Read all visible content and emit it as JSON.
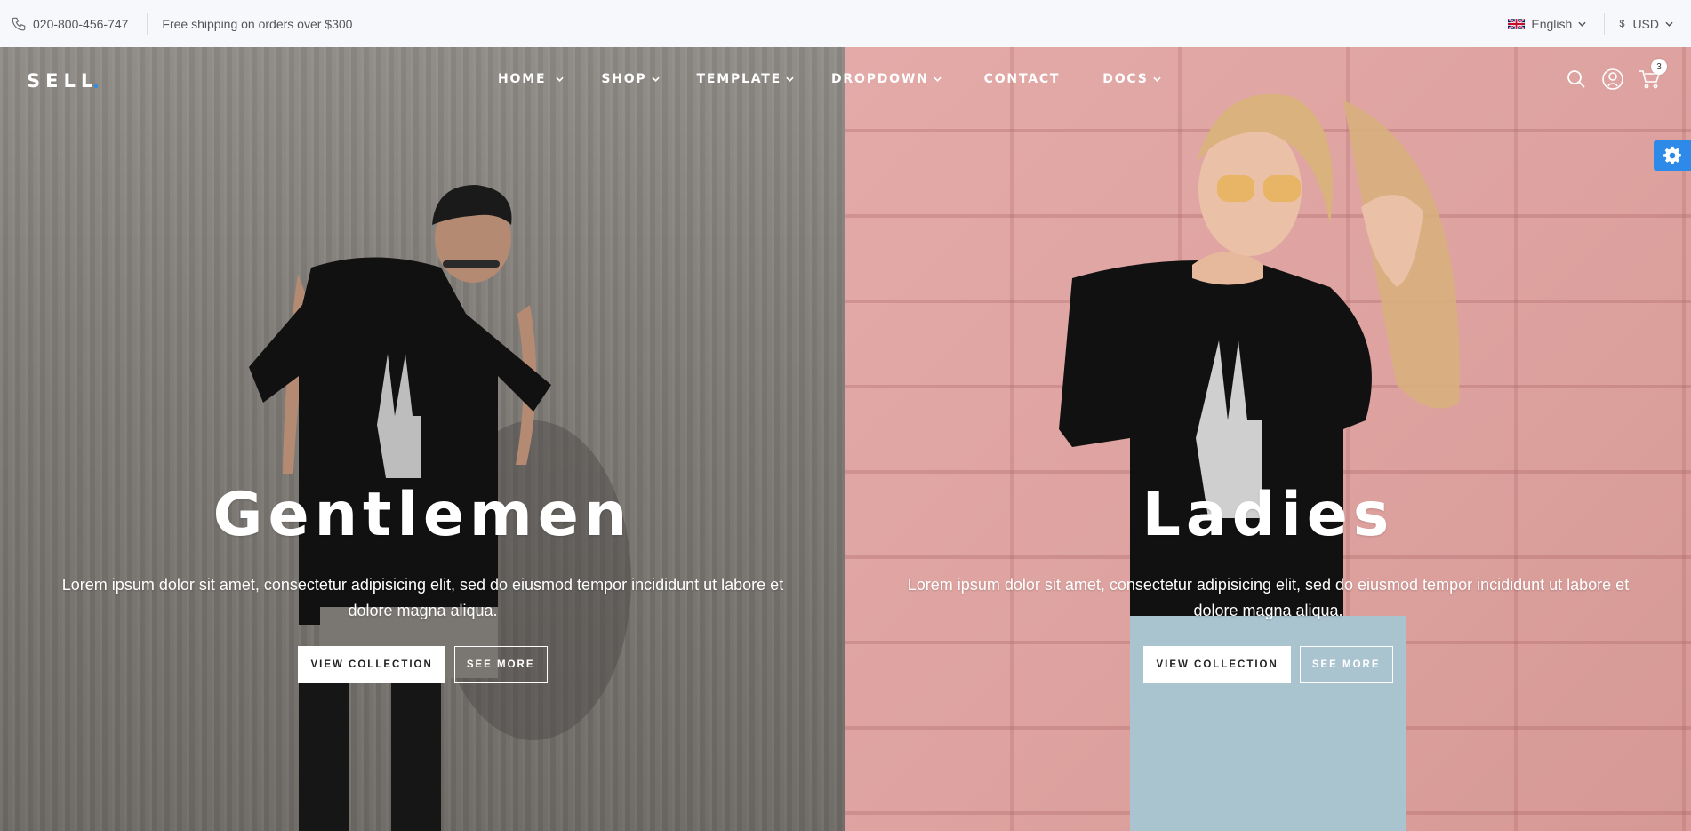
{
  "topbar": {
    "phone": "020-800-456-747",
    "shipping": "Free shipping on orders over $300",
    "language": "English",
    "currency_symbol": "$",
    "currency": "USD"
  },
  "header": {
    "logo": "SELL",
    "nav": [
      "HOME",
      "SHOP",
      "TEMPLATE",
      "DROPDOWN",
      "CONTACT",
      "DOCS"
    ],
    "cart_count": "3"
  },
  "hero": {
    "gentlemen": {
      "title": "Gentlemen",
      "text": "Lorem ipsum dolor sit amet, consectetur adipisicing elit, sed do eiusmod tempor incididunt ut labore et dolore magna aliqua.",
      "primary_button": "VIEW COLLECTION",
      "secondary_button": "SEE MORE"
    },
    "ladies": {
      "title": "Ladies",
      "text": "Lorem ipsum dolor sit amet, consectetur adipisicing elit, sed do eiusmod tempor incididunt ut labore et dolore magna aliqua.",
      "primary_button": "VIEW COLLECTION",
      "secondary_button": "SEE MORE"
    }
  },
  "colors": {
    "accent": "#2d8ae8",
    "topbar_bg": "#f6f8fb",
    "concrete": "#827e79",
    "pink_wall": "#dea3a0"
  },
  "icons": [
    "phone-icon",
    "uk-flag-icon",
    "search-icon",
    "user-icon",
    "cart-icon",
    "gear-icon"
  ]
}
